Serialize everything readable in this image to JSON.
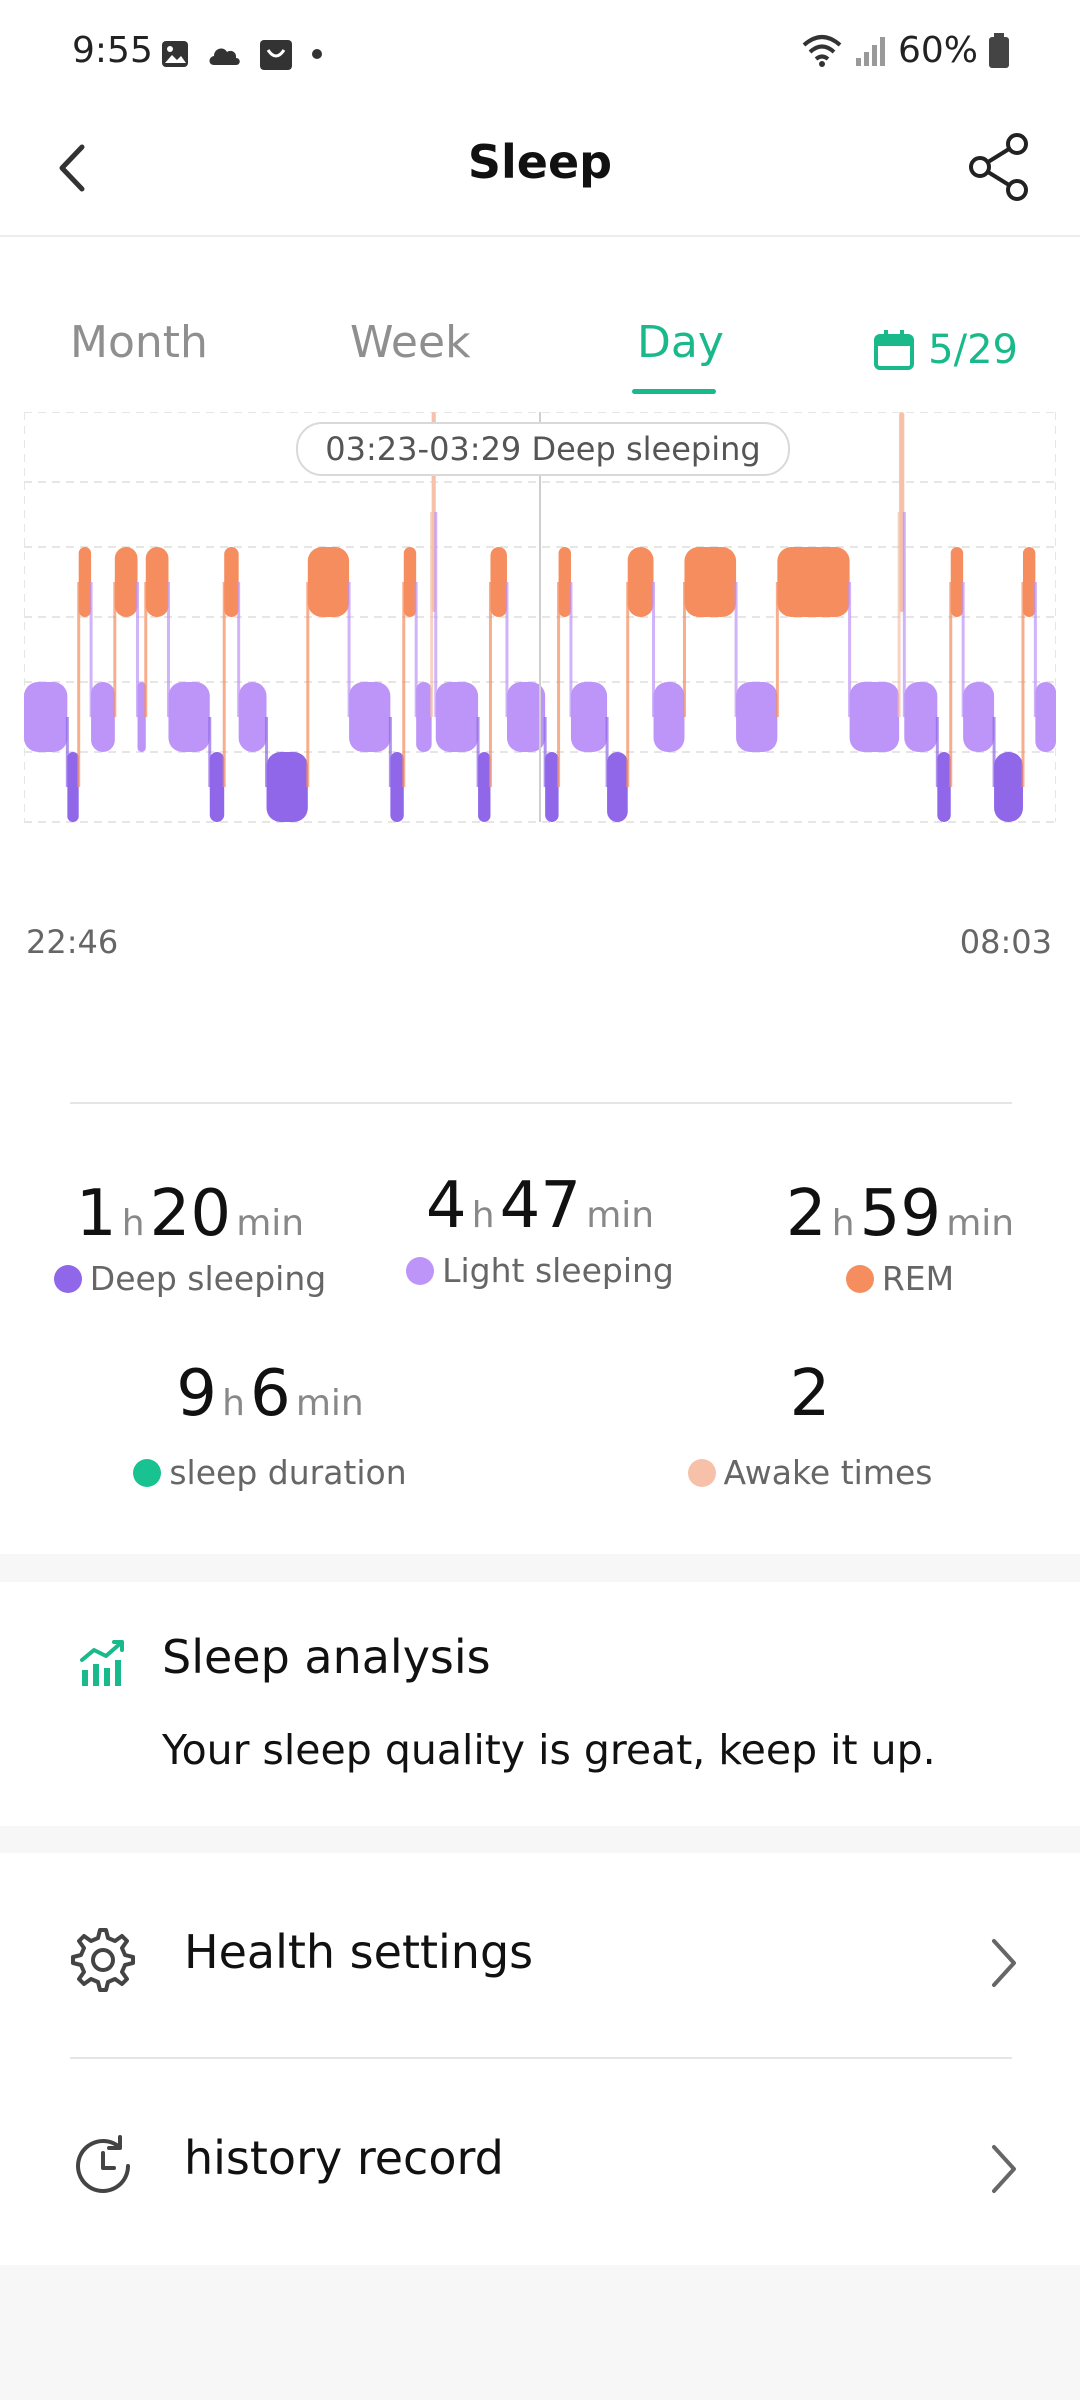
{
  "status": {
    "time": "9:55",
    "battery": "60%",
    "left_icons": [
      "gallery-icon",
      "cloud-icon",
      "shop-icon",
      "dot-icon"
    ],
    "right_icons": [
      "wifi-icon",
      "signal-icon",
      "battery-icon"
    ]
  },
  "header": {
    "title": "Sleep",
    "back_icon": "chevron-left-icon",
    "share_icon": "share-icon"
  },
  "tabs": [
    {
      "label": "Month",
      "active": false
    },
    {
      "label": "Week",
      "active": false
    },
    {
      "label": "Day",
      "active": true
    }
  ],
  "date": {
    "label": "5/29",
    "icon": "calendar-icon"
  },
  "chart_data": {
    "type": "area",
    "tooltip": "03:23-03:29 Deep sleeping",
    "time_start": "22:46",
    "time_end": "08:03",
    "levels": [
      "REM",
      "Light sleeping",
      "Deep sleeping"
    ],
    "colors": {
      "deep": "#8f67e8",
      "light": "#bd94f7",
      "rem": "#f58d5e",
      "awake": "#f6c1a8"
    },
    "segments": [
      {
        "stage": "light",
        "start": 0.0,
        "end": 0.042
      },
      {
        "stage": "deep",
        "start": 0.042,
        "end": 0.053
      },
      {
        "stage": "rem",
        "start": 0.053,
        "end": 0.065
      },
      {
        "stage": "light",
        "start": 0.065,
        "end": 0.088
      },
      {
        "stage": "rem",
        "start": 0.088,
        "end": 0.11
      },
      {
        "stage": "light",
        "start": 0.11,
        "end": 0.118
      },
      {
        "stage": "rem",
        "start": 0.118,
        "end": 0.14
      },
      {
        "stage": "light",
        "start": 0.14,
        "end": 0.18
      },
      {
        "stage": "deep",
        "start": 0.18,
        "end": 0.194
      },
      {
        "stage": "rem",
        "start": 0.194,
        "end": 0.208
      },
      {
        "stage": "light",
        "start": 0.208,
        "end": 0.235
      },
      {
        "stage": "deep",
        "start": 0.235,
        "end": 0.275
      },
      {
        "stage": "rem",
        "start": 0.275,
        "end": 0.315
      },
      {
        "stage": "light",
        "start": 0.315,
        "end": 0.355
      },
      {
        "stage": "deep",
        "start": 0.355,
        "end": 0.368
      },
      {
        "stage": "rem",
        "start": 0.368,
        "end": 0.38
      },
      {
        "stage": "light",
        "start": 0.38,
        "end": 0.395
      },
      {
        "stage": "awake",
        "start": 0.395,
        "end": 0.399
      },
      {
        "stage": "light",
        "start": 0.399,
        "end": 0.44
      },
      {
        "stage": "deep",
        "start": 0.44,
        "end": 0.452
      },
      {
        "stage": "rem",
        "start": 0.452,
        "end": 0.468
      },
      {
        "stage": "light",
        "start": 0.468,
        "end": 0.505
      },
      {
        "stage": "deep",
        "start": 0.505,
        "end": 0.518
      },
      {
        "stage": "rem",
        "start": 0.518,
        "end": 0.53
      },
      {
        "stage": "light",
        "start": 0.53,
        "end": 0.565
      },
      {
        "stage": "deep",
        "start": 0.565,
        "end": 0.585
      },
      {
        "stage": "rem",
        "start": 0.585,
        "end": 0.61
      },
      {
        "stage": "light",
        "start": 0.61,
        "end": 0.64
      },
      {
        "stage": "rem",
        "start": 0.64,
        "end": 0.69
      },
      {
        "stage": "light",
        "start": 0.69,
        "end": 0.73
      },
      {
        "stage": "rem",
        "start": 0.73,
        "end": 0.8
      },
      {
        "stage": "light",
        "start": 0.8,
        "end": 0.848
      },
      {
        "stage": "awake",
        "start": 0.848,
        "end": 0.853
      },
      {
        "stage": "light",
        "start": 0.853,
        "end": 0.885
      },
      {
        "stage": "deep",
        "start": 0.885,
        "end": 0.898
      },
      {
        "stage": "rem",
        "start": 0.898,
        "end": 0.91
      },
      {
        "stage": "light",
        "start": 0.91,
        "end": 0.94
      },
      {
        "stage": "deep",
        "start": 0.94,
        "end": 0.968
      },
      {
        "stage": "rem",
        "start": 0.968,
        "end": 0.98
      },
      {
        "stage": "light",
        "start": 0.98,
        "end": 1.0
      }
    ]
  },
  "stats": {
    "deep": {
      "h": "1",
      "min": "20",
      "label": "Deep sleeping",
      "h_unit": "h",
      "min_unit": "min"
    },
    "light": {
      "h": "4",
      "min": "47",
      "label": "Light sleeping",
      "h_unit": "h",
      "min_unit": "min"
    },
    "rem": {
      "h": "2",
      "min": "59",
      "label": "REM",
      "h_unit": "h",
      "min_unit": "min"
    },
    "duration": {
      "h": "9",
      "min": "6",
      "label": "sleep duration",
      "h_unit": "h",
      "min_unit": "min"
    },
    "awake": {
      "value": "2",
      "label": "Awake times"
    }
  },
  "analysis": {
    "title": "Sleep analysis",
    "text": "Your sleep quality is great, keep it up.",
    "icon": "chart-trend-icon"
  },
  "menu": [
    {
      "label": "Health settings",
      "icon": "gear-icon"
    },
    {
      "label": "history record",
      "icon": "history-icon"
    }
  ]
}
